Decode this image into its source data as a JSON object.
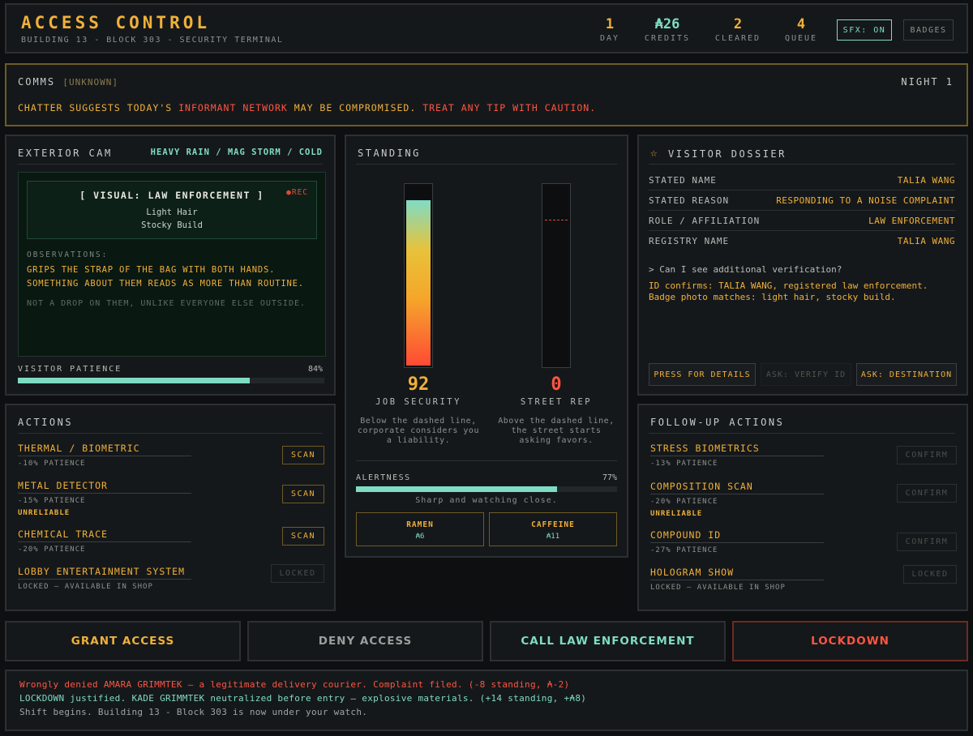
{
  "header": {
    "title": "ACCESS CONTROL",
    "subtitle": "BUILDING 13 - BLOCK 303 - SECURITY TERMINAL",
    "stats": [
      {
        "value": "1",
        "label": "DAY"
      },
      {
        "value": "₳26",
        "label": "CREDITS"
      },
      {
        "value": "2",
        "label": "CLEARED"
      },
      {
        "value": "4",
        "label": "QUEUE"
      }
    ],
    "sfx_label": "SFX: ON",
    "badges_label": "BADGES"
  },
  "comms": {
    "title": "COMMS",
    "tag": "[UNKNOWN]",
    "night": "NIGHT 1",
    "msg_1": "CHATTER SUGGESTS TODAY'S ",
    "msg_2": "INFORMANT NETWORK",
    "msg_3": " MAY BE COMPROMISED. ",
    "msg_4": "TREAT ANY TIP WITH CAUTION",
    "msg_5": "."
  },
  "camera": {
    "title": "EXTERIOR CAM",
    "weather": "HEAVY RAIN / MAG STORM / COLD",
    "visual": "[ VISUAL: LAW ENFORCEMENT ]",
    "rec": "●REC",
    "traits": [
      "Light Hair",
      "Stocky Build"
    ],
    "obs_label": "OBSERVATIONS:",
    "obs_text": "GRIPS THE STRAP OF THE BAG WITH BOTH HANDS. SOMETHING ABOUT THEM READS AS MORE THAN ROUTINE.",
    "obs_note": "NOT A DROP ON THEM, UNLIKE EVERYONE ELSE OUTSIDE.",
    "patience_label": "VISITOR PATIENCE",
    "patience_value": "84%",
    "patience_pct": 84
  },
  "standing": {
    "title": "STANDING",
    "job_value": "92",
    "job_pct": 92,
    "job_label": "JOB SECURITY",
    "job_desc": "Below the dashed line, corporate considers you a liability.",
    "rep_value": "0",
    "rep_pct": 0,
    "rep_label": "STREET REP",
    "rep_desc": "Above the dashed line, the street starts asking favors.",
    "alert_label": "ALERTNESS",
    "alert_value": "77%",
    "alert_pct": 77,
    "alert_desc": "Sharp and watching close.",
    "shop": [
      {
        "name": "RAMEN",
        "price": "₳6"
      },
      {
        "name": "CAFFEINE",
        "price": "₳11"
      }
    ]
  },
  "dossier": {
    "title": "VISITOR DOSSIER",
    "rows": [
      {
        "k": "STATED NAME",
        "v": "TALIA WANG"
      },
      {
        "k": "STATED REASON",
        "v": "RESPONDING TO A NOISE COMPLAINT"
      },
      {
        "k": "ROLE / AFFILIATION",
        "v": "LAW ENFORCEMENT"
      },
      {
        "k": "REGISTRY NAME",
        "v": "TALIA WANG"
      }
    ],
    "question": "> Can I see additional verification?",
    "answer_1": "ID confirms: TALIA WANG, registered law enforcement.",
    "answer_2": "Badge photo matches: light hair, stocky build.",
    "press_btn": "PRESS FOR DETAILS",
    "verify_btn": "ASK: VERIFY ID",
    "dest_btn": "ASK: DESTINATION"
  },
  "actions": {
    "title": "ACTIONS",
    "items": [
      {
        "name": "THERMAL / BIOMETRIC",
        "cost": "-10% PATIENCE",
        "btn": "SCAN"
      },
      {
        "name": "METAL DETECTOR",
        "cost": "-15% PATIENCE",
        "note": "UNRELIABLE",
        "btn": "SCAN"
      },
      {
        "name": "CHEMICAL TRACE",
        "cost": "-20% PATIENCE",
        "btn": "SCAN"
      },
      {
        "name": "LOBBY ENTERTAINMENT SYSTEM",
        "cost": "LOCKED — AVAILABLE IN SHOP",
        "btn": "LOCKED"
      }
    ]
  },
  "followup": {
    "title": "FOLLOW-UP ACTIONS",
    "items": [
      {
        "name": "STRESS BIOMETRICS",
        "cost": "-13% PATIENCE",
        "btn": "CONFIRM"
      },
      {
        "name": "COMPOSITION SCAN",
        "cost": "-20% PATIENCE",
        "note": "UNRELIABLE",
        "btn": "CONFIRM"
      },
      {
        "name": "COMPOUND ID",
        "cost": "-27% PATIENCE",
        "btn": "CONFIRM"
      },
      {
        "name": "HOLOGRAM SHOW",
        "cost": "LOCKED — AVAILABLE IN SHOP",
        "btn": "LOCKED"
      }
    ]
  },
  "decisions": {
    "grant": "GRANT ACCESS",
    "deny": "DENY ACCESS",
    "call": "CALL LAW ENFORCEMENT",
    "lockdown": "LOCKDOWN"
  },
  "log": [
    "Wrongly denied AMARA GRIMMTEK — a legitimate delivery courier. Complaint filed. (-8 standing, ₳-2)",
    "LOCKDOWN justified. KADE GRIMMTEK neutralized before entry — explosive materials. (+14 standing, +₳8)",
    "Shift begins. Building 13 - Block 303 is now under your watch."
  ],
  "colors": {
    "accent": "#f0b03a",
    "teal": "#7fdcc4",
    "danger": "#ff5540"
  }
}
